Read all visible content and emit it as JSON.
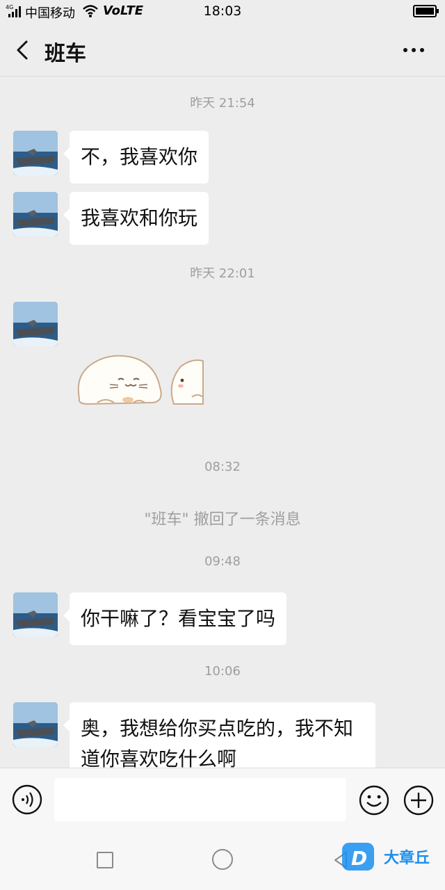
{
  "status_bar": {
    "network": "4G",
    "carrier": "中国移动",
    "volte": "VoLTE",
    "time": "18:03"
  },
  "header": {
    "title": "班车"
  },
  "messages": {
    "ts1": "昨天 21:54",
    "msg1": "不，我喜欢你",
    "msg2": "我喜欢和你玩",
    "ts2": "昨天 22:01",
    "ts3": "08:32",
    "recall_notice": "\"班车\" 撤回了一条消息",
    "ts4": "09:48",
    "msg3": "你干嘛了？看宝宝了吗",
    "ts5": "10:06",
    "msg4_line1": "奥，我想给你买点吃的，我不知",
    "msg4_line2": "道你喜欢吃什么啊"
  },
  "watermark": {
    "logo_letter": "D",
    "text": "大章丘"
  },
  "colors": {
    "background": "#ededed",
    "bubble": "#ffffff",
    "timestamp": "#9e9e9e",
    "watermark": "#1a8ff0"
  }
}
